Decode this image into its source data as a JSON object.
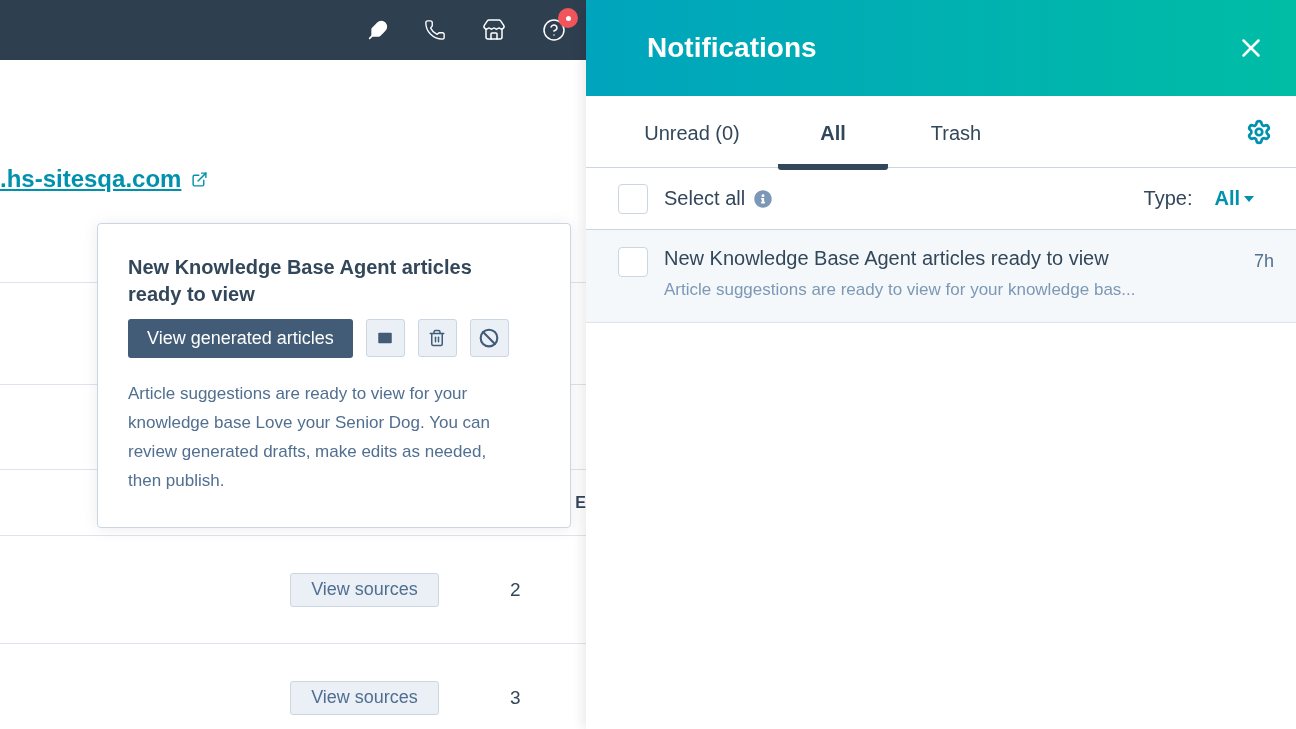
{
  "topbar": {
    "help_badge": true
  },
  "page": {
    "link": ".hs-sitesqa.com",
    "column_header": "E",
    "rows": [
      {
        "action": "View sources",
        "count": "2"
      },
      {
        "action": "View sources",
        "count": "3"
      }
    ]
  },
  "popover": {
    "title": "New Knowledge Base Agent articles ready to view",
    "primary_button": "View generated articles",
    "body": "Article suggestions are ready to view for your knowledge base Love your Senior Dog. You can review generated drafts, make edits as needed, then publish."
  },
  "panel": {
    "title": "Notifications",
    "tabs": [
      {
        "label": "Unread (0)",
        "selected": false
      },
      {
        "label": "All",
        "selected": true
      },
      {
        "label": "Trash",
        "selected": false
      }
    ],
    "select_all": {
      "label": "Select all",
      "checked": false
    },
    "type_filter": {
      "label": "Type:",
      "value": "All"
    },
    "notifications": [
      {
        "title": "New Knowledge Base Agent articles ready to view",
        "preview": "Article suggestions are ready to view for your knowledge bas...",
        "time": "7h",
        "checked": false
      }
    ]
  }
}
